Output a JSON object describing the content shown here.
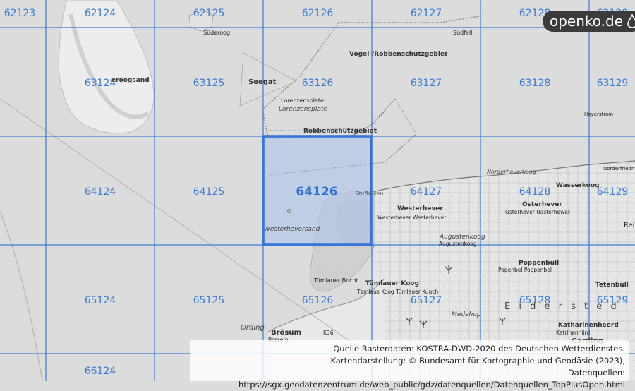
{
  "grid": {
    "cells": [
      "62123",
      "62124",
      "62125",
      "62126",
      "62127",
      "62128",
      "62129",
      "63124",
      "63125",
      "63126",
      "63127",
      "63128",
      "63129",
      "64124",
      "64125",
      "64127",
      "64128",
      "64129",
      "65124",
      "65125",
      "65126",
      "65127",
      "65128",
      "65129",
      "66124"
    ]
  },
  "highlight": {
    "label": "64126",
    "color": "#2f6fd6"
  },
  "places": {
    "sueder_oog": "Süderoog",
    "sudfall": "Südfall",
    "vogel": "Vogel-/Robbenschutzgebiet",
    "eroogsand": "eroogsand",
    "seegat": "Seegat",
    "lorenzensplate_1": "Lorenzensplate",
    "lorenzensplate_2": "Lorenzensplate",
    "robbenschutzgebiet": "Robbenschutzgebiet",
    "norderheverkoog": "Norderheverkoog",
    "norderfriedrichs": "Norderfriedrichskoog",
    "hoyerstrom": "Hoyerstrom",
    "wasserkoog": "Wasserkoog",
    "stufhusen": "Stufhusen",
    "westerhever": "Westerhever",
    "westerhever_sub": "Westerhever Westerhever",
    "osterhever": "Osterhever",
    "osterhever_sub": "Osterhever Uasterhewer",
    "westerheversand": "Westerheversand",
    "augustenkoog": "Augustenkoog",
    "augustenkoog_sub": "Augustenkoog",
    "poppenbuell": "Poppenbüll",
    "poppenbuell_sub": "Popenbel Poppenbel",
    "tetenbuell": "Tetenbüll",
    "tuemlauer_bucht": "Tümlauer Bucht",
    "tuemlauer_koog": "Tümlauer Koog",
    "tuemlauer_sub": "Tømlaus Koog Tümlauer Kuuch",
    "medehop": "Medehop",
    "eiderstedt": "E i d e r s t e d",
    "katharinenheerd": "Katharinenheerd",
    "katharinen_sub": "Katrinenhiird",
    "ording": "Ording",
    "broesum": "Brösum",
    "broesum_sub": "Brøsem",
    "road_k36": "K36",
    "garding": "Garding",
    "rei": "Rei"
  },
  "logo": {
    "text": "openko.de"
  },
  "attribution": {
    "line1": "Quelle Rasterdaten: KOSTRA-DWD-2020 des Deutschen Wetterdienstes.",
    "line2": "Kartendarstellung: © Bundesamt für Kartographie und Geodäsie (2023),",
    "line3": "Datenquellen: https://sgx.geodatenzentrum.de/web_public/gdz/datenquellen/Datenquellen_TopPlusOpen.html"
  },
  "colors": {
    "grid_line": "#3a7bd5",
    "sea": "#dcdcdc",
    "land": "#ebebeb",
    "sand": "#d2d2d2"
  }
}
